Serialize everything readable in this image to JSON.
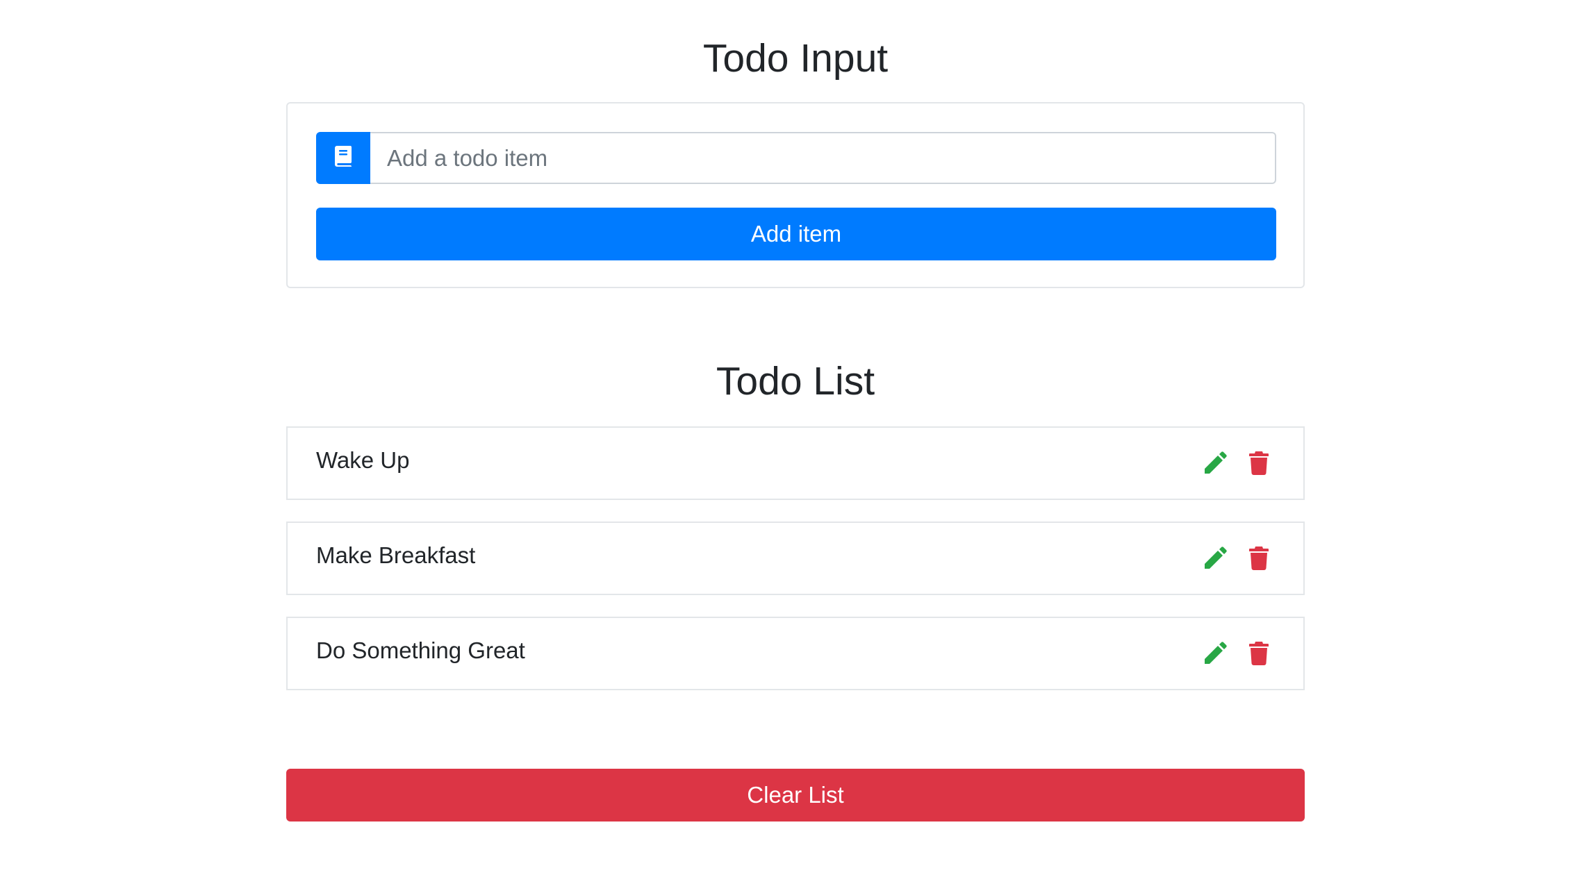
{
  "input_section": {
    "title": "Todo Input",
    "icon": "book-icon",
    "placeholder": "Add a todo item",
    "value": "",
    "add_label": "Add item"
  },
  "list_section": {
    "title": "Todo List",
    "items": [
      {
        "label": "Wake Up"
      },
      {
        "label": "Make Breakfast"
      },
      {
        "label": "Do Something Great"
      }
    ],
    "clear_label": "Clear List"
  },
  "colors": {
    "primary": "#007bff",
    "danger": "#dc3545",
    "success": "#28a745",
    "text": "#212529"
  }
}
